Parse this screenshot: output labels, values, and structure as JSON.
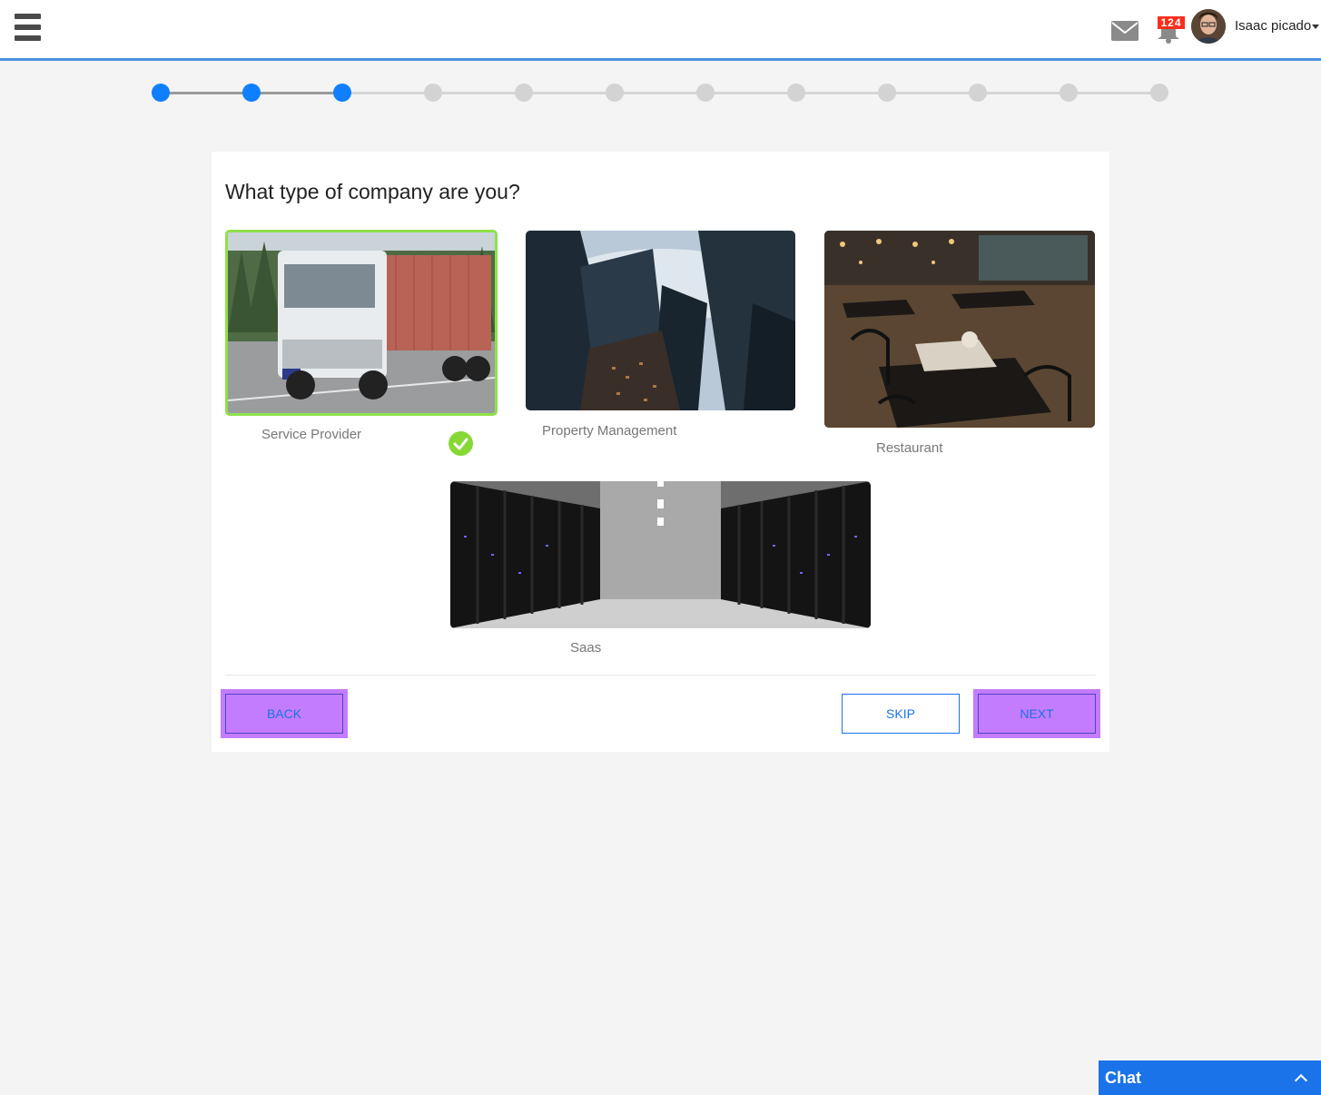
{
  "header": {
    "user_name": "Isaac picado",
    "notification_count": "124",
    "accent_color": "#4a90e2",
    "icons": [
      "menu-icon",
      "mail-icon",
      "bell-icon",
      "caret-down-icon"
    ]
  },
  "stepper": {
    "total_steps": 12,
    "current_step": 3,
    "active_color": "#0f7fff",
    "inactive_color": "#d3d3d3"
  },
  "form": {
    "question": "What type of company are you?",
    "options": [
      {
        "label": "Service Provider",
        "selected": true
      },
      {
        "label": "Property Management",
        "selected": false
      },
      {
        "label": "Restaurant",
        "selected": false
      },
      {
        "label": "Saas",
        "selected": false
      }
    ],
    "selected_color": "#8fe04a"
  },
  "actions": {
    "back_label": "BACK",
    "skip_label": "SKIP",
    "next_label": "NEXT"
  },
  "chat": {
    "label": "Chat",
    "color": "#1a73e8"
  }
}
